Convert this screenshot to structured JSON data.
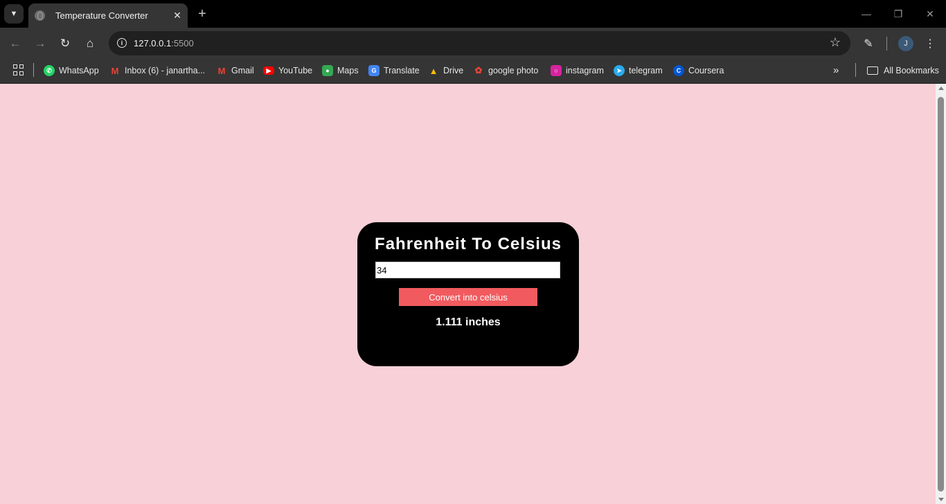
{
  "browser": {
    "tab_title": "Temperature Converter",
    "url_host": "127.0.0.1",
    "url_port": ":5500",
    "profile_initial": "J"
  },
  "bookmarks": [
    {
      "label": "WhatsApp",
      "icon": "whatsapp-icon",
      "color": "#25d366"
    },
    {
      "label": "Inbox (6) - janartha...",
      "icon": "gmail-icon",
      "color": "#ea4335"
    },
    {
      "label": "Gmail",
      "icon": "gmail-icon",
      "color": "#ea4335"
    },
    {
      "label": "YouTube",
      "icon": "youtube-icon",
      "color": "#ff0000"
    },
    {
      "label": "Maps",
      "icon": "maps-icon",
      "color": "#34a853"
    },
    {
      "label": "Translate",
      "icon": "translate-icon",
      "color": "#4285f4"
    },
    {
      "label": "Drive",
      "icon": "drive-icon",
      "color": "#fbbc04"
    },
    {
      "label": "google photo",
      "icon": "photos-icon",
      "color": "#ea4335"
    },
    {
      "label": "instagram",
      "icon": "instagram-icon",
      "color": "#d6249f"
    },
    {
      "label": "telegram",
      "icon": "telegram-icon",
      "color": "#2aabee"
    },
    {
      "label": "Coursera",
      "icon": "coursera-icon",
      "color": "#0056d2"
    }
  ],
  "all_bookmarks_label": "All Bookmarks",
  "page": {
    "background": "#f8d0d8",
    "title": "Fahrenheit To Celsius",
    "input_value": "34",
    "button_label": "Convert into celsius",
    "button_color": "#f15b5f",
    "result": "1.111 inches"
  }
}
